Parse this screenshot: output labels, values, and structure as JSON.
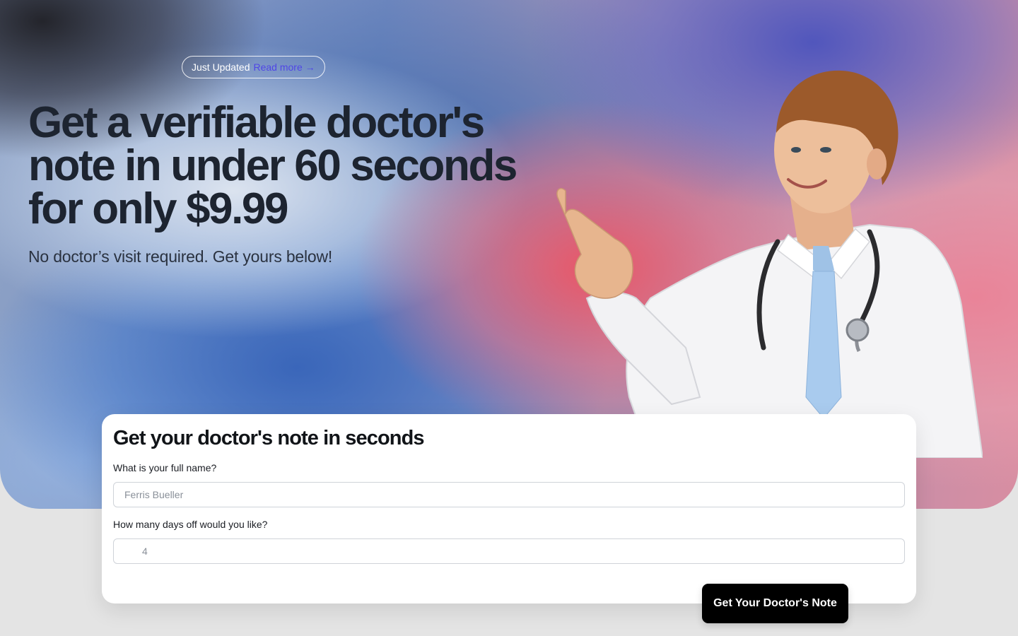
{
  "hero": {
    "badge": {
      "label": "Just Updated",
      "link_text": "Read more →"
    },
    "headline": "Get a verifiable doctor's note in under 60 seconds for only $9.99",
    "subheadline": "No doctor’s visit required. Get yours below!",
    "image_subject": "doctor-pointing"
  },
  "form": {
    "title": "Get your doctor's note in seconds",
    "name_field": {
      "label": "What is your full name?",
      "placeholder": "Ferris Bueller",
      "value": ""
    },
    "days_field": {
      "label": "How many days off would you like?",
      "placeholder": "4",
      "value": "",
      "icon": "calendar-clock-icon"
    },
    "submit_label": "Get Your Doctor's Note"
  },
  "colors": {
    "badge_link": "#4f46e5",
    "headline": "#1d2430",
    "cta_background": "#000000",
    "page_background": "#e4e4e4"
  }
}
